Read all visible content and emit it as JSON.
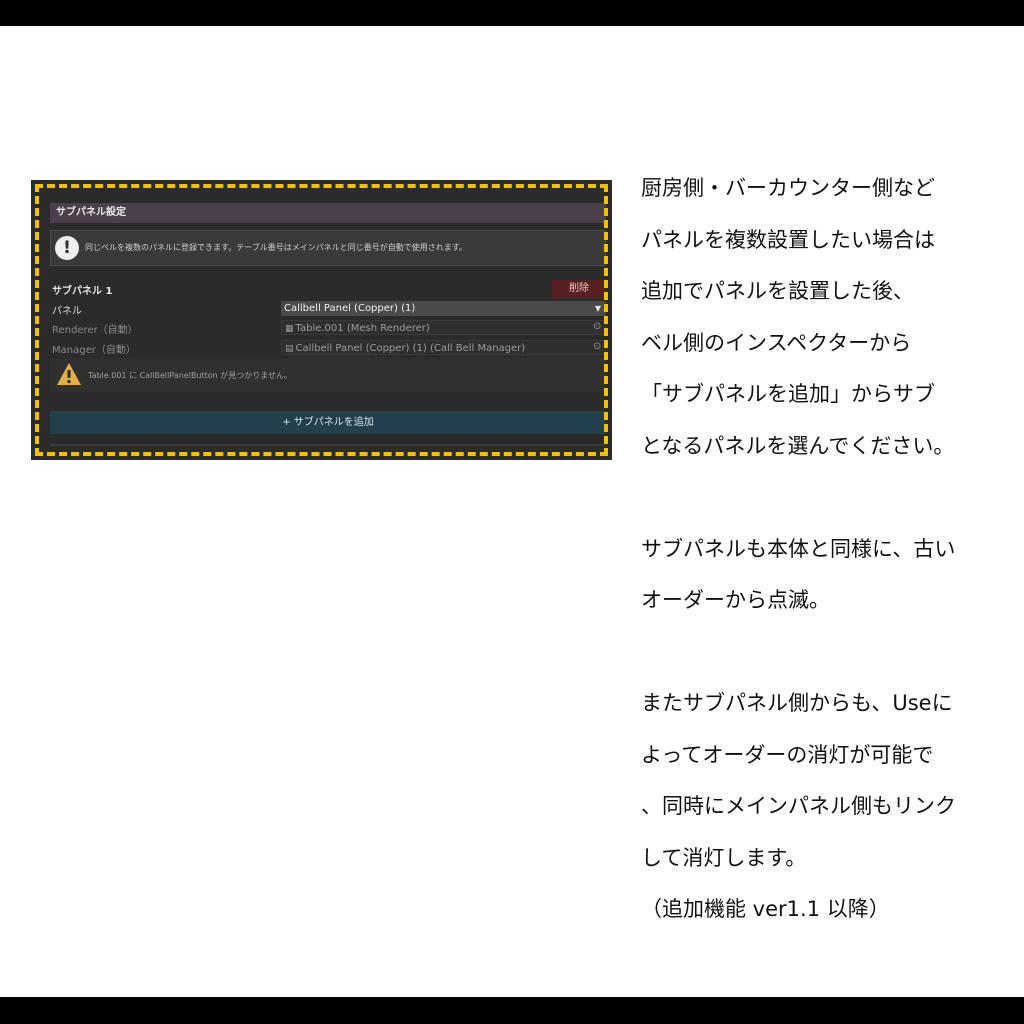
{
  "inspector": {
    "section_title": "サブパネル設定",
    "info_text": "同じベルを複数のパネルに登録できます。テーブル番号はメインパネルと同じ番号が自動で使用されます。",
    "subpanel_title": "サブパネル 1",
    "delete_label": "削除",
    "rows": [
      {
        "label": "パネル",
        "value": "Callbell Panel (Copper) (1)"
      },
      {
        "label": "Renderer（自動）",
        "value": "Table.001 (Mesh Renderer)"
      },
      {
        "label": "Manager（自動）",
        "value": "Callbell Panel (Copper) (1) (Call Bell Manager)"
      }
    ],
    "warning_text": "Table.001 に CallBellPanelButton が見つかりません。",
    "add_label": "+ サブパネルを追加",
    "highlight_color": "#f2c200"
  },
  "description": {
    "para1": [
      "厨房側・バーカウンター側など",
      "パネルを複数設置したい場合は",
      "追加でパネルを設置した後、",
      "ベル側のインスペクターから",
      "「サブパネルを追加」からサブ",
      "となるパネルを選んでください。"
    ],
    "para2": [
      "サブパネルも本体と同様に、古い",
      "オーダーから点滅。"
    ],
    "para3": [
      "またサブパネル側からも、Useに",
      "よってオーダーの消灯が可能で",
      "、同時にメインパネル側もリンク",
      "して消灯します。",
      "（追加機能 ver1.1 以降）"
    ]
  }
}
